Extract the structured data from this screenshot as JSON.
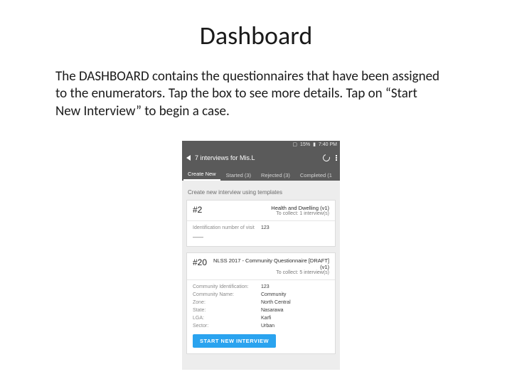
{
  "title": "Dashboard",
  "body_text_pre": "The ",
  "body_text_caps": "DASHBOARD",
  "body_text_post": " contains the questionnaires that have been assigned to the enumerators. Tap the box to see more details. Tap on “Start New Interview” to begin a case.",
  "statusbar": {
    "battery": "15%",
    "time": "7:40 PM"
  },
  "appbar": {
    "title": "7 interviews for Mis.L"
  },
  "tabs": {
    "create": "Create New",
    "started": "Started (3)",
    "rejected": "Rejected (3)",
    "completed": "Completed (1"
  },
  "section_label": "Create new interview using templates",
  "card1": {
    "num": "#2",
    "title": "Health and Dwelling (v1)",
    "sub": "To collect: 1 interview(s)",
    "kv": {
      "k": "Identification number of visit",
      "v": "123"
    },
    "more": "–––"
  },
  "card2": {
    "num": "#20",
    "title": "NLSS 2017 - Community Questionnaire [DRAFT] (v1)",
    "sub": "To collect: 5 interview(s)",
    "rows": [
      {
        "k": "Community Identification:",
        "v": "123"
      },
      {
        "k": "Community Name:",
        "v": "Community"
      },
      {
        "k": "Zone:",
        "v": "North Central"
      },
      {
        "k": "State:",
        "v": "Nasarawa"
      },
      {
        "k": "LGA:",
        "v": "Karfi"
      },
      {
        "k": "Sector:",
        "v": "Urban"
      }
    ],
    "button": "START NEW INTERVIEW"
  }
}
